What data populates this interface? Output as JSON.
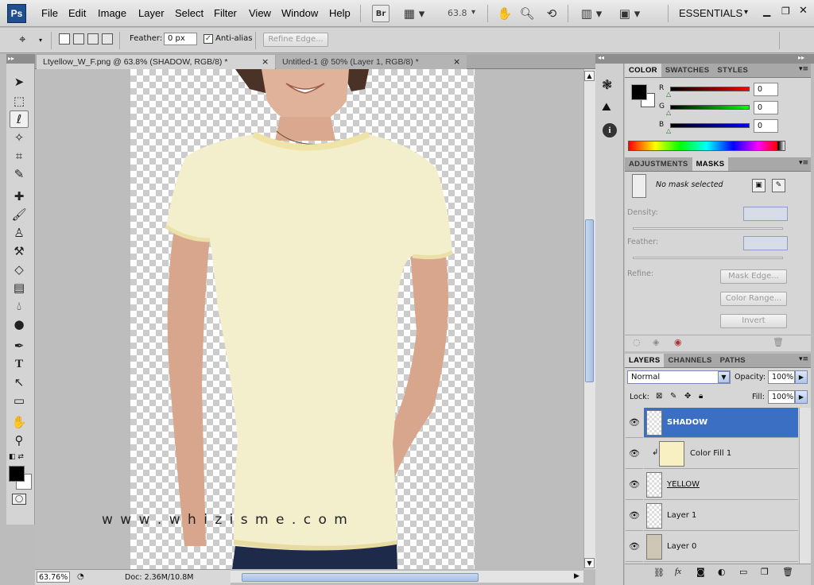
{
  "app": {
    "logo": "Ps",
    "workspace": "ESSENTIALS"
  },
  "menu": [
    "File",
    "Edit",
    "Image",
    "Layer",
    "Select",
    "Filter",
    "View",
    "Window",
    "Help"
  ],
  "appbar": {
    "bridge": "Br",
    "zoom": "63.8"
  },
  "options": {
    "feather_label": "Feather:",
    "feather_value": "0 px",
    "antialias_label": "Anti-alias",
    "antialias_checked": true,
    "refine_edge": "Refine Edge..."
  },
  "tabs": [
    {
      "label": "Ltyellow_W_F.png @ 63.8% (SHADOW, RGB/8) *",
      "close": "×",
      "active": true
    },
    {
      "label": "Untitled-1 @ 50% (Layer 1, RGB/8) *",
      "close": "×",
      "active": false
    }
  ],
  "canvas": {
    "watermark": "w w w . w h i z i s m e . c o m"
  },
  "status": {
    "zoom": "63.76%",
    "doc": "Doc: 2.36M/10.8M"
  },
  "color_panel": {
    "tabs": [
      "COLOR",
      "SWATCHES",
      "STYLES"
    ],
    "channels": [
      {
        "label": "R",
        "value": "0",
        "color": "#d00000"
      },
      {
        "label": "G",
        "value": "0",
        "color": "#00b000"
      },
      {
        "label": "B",
        "value": "0",
        "color": "#0000d0"
      }
    ]
  },
  "masks_panel": {
    "tabs": [
      "ADJUSTMENTS",
      "MASKS"
    ],
    "status": "No mask selected",
    "density": "Density:",
    "feather": "Feather:",
    "refine": "Refine:",
    "mask_edge": "Mask Edge...",
    "color_range": "Color Range...",
    "invert": "Invert"
  },
  "layers_panel": {
    "tabs": [
      "LAYERS",
      "CHANNELS",
      "PATHS"
    ],
    "blend": "Normal",
    "opacity_label": "Opacity:",
    "opacity": "100%",
    "lock_label": "Lock:",
    "fill_label": "Fill:",
    "fill": "100%",
    "layers": [
      {
        "name": "SHADOW",
        "selected": true
      },
      {
        "name": "Color Fill 1",
        "selected": false
      },
      {
        "name": "YELLOW",
        "selected": false
      },
      {
        "name": "Layer 1",
        "selected": false
      },
      {
        "name": "Layer 0",
        "selected": false
      }
    ]
  },
  "colors": {
    "accent": "#3a6fc4",
    "shirt": "#f3efcd",
    "jeans": "#1e2a4a"
  }
}
